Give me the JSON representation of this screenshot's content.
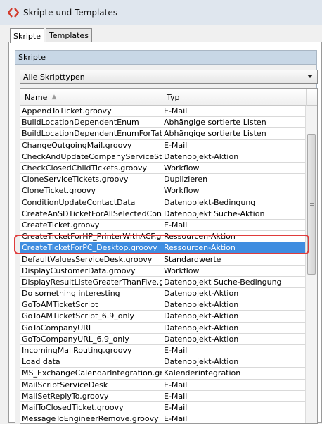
{
  "window": {
    "title": "Skripte und Templates"
  },
  "tabs": [
    {
      "label": "Skripte",
      "active": true
    },
    {
      "label": "Templates",
      "active": false
    }
  ],
  "group": {
    "header": "Skripte"
  },
  "filter": {
    "selected": "Alle Skripttypen"
  },
  "table": {
    "columns": [
      "Name",
      "Typ"
    ],
    "sort_indicator": "▲",
    "rows": [
      {
        "name": "AppendToTicket.groovy",
        "type": "E-Mail"
      },
      {
        "name": "BuildLocationDependentEnum",
        "type": "Abhängige sortierte Listen"
      },
      {
        "name": "BuildLocationDependentEnumForTable",
        "type": "Abhängige sortierte Listen"
      },
      {
        "name": "ChangeOutgoingMail.groovy",
        "type": "E-Mail"
      },
      {
        "name": "CheckAndUpdateCompanyServiceStatus",
        "type": "Datenobjekt-Aktion"
      },
      {
        "name": "CheckClosedChildTickets.groovy",
        "type": "Workflow"
      },
      {
        "name": "CloneServiceTickets.groovy",
        "type": "Duplizieren"
      },
      {
        "name": "CloneTicket.groovy",
        "type": "Workflow"
      },
      {
        "name": "ConditionUpdateContactData",
        "type": "Datenobjekt-Bedingung"
      },
      {
        "name": "CreateAnSDTicketForAllSelectedContacts",
        "type": "Datenobjekt Suche-Aktion"
      },
      {
        "name": "CreateTicket.groovy",
        "type": "E-Mail"
      },
      {
        "name": "CreateTicketForHP_PrinterWithACF.gr...",
        "type": "Ressourcen-Aktion"
      },
      {
        "name": "CreateTicketForPC_Desktop.groovy",
        "type": "Ressourcen-Aktion"
      },
      {
        "name": "DefaultValuesServiceDesk.groovy",
        "type": "Standardwerte"
      },
      {
        "name": "DisplayCustomerData.groovy",
        "type": "Workflow"
      },
      {
        "name": "DisplayResultListeGreaterThanFive.gro...",
        "type": "Datenobjekt Suche-Bedingung"
      },
      {
        "name": "Do something interesting",
        "type": "Datenobjekt-Aktion"
      },
      {
        "name": "GoToAMTicketScript",
        "type": "Datenobjekt-Aktion"
      },
      {
        "name": "GoToAMTicketScript_6.9_only",
        "type": "Datenobjekt-Aktion"
      },
      {
        "name": "GoToCompanyURL",
        "type": "Datenobjekt-Aktion"
      },
      {
        "name": "GoToCompanyURL_6.9_only",
        "type": "Datenobjekt-Aktion"
      },
      {
        "name": "IncomingMailRouting.groovy",
        "type": "E-Mail"
      },
      {
        "name": "Load data",
        "type": "Datenobjekt-Aktion"
      },
      {
        "name": "MS_ExchangeCalendarIntegration.gro...",
        "type": "Kalenderintegration"
      },
      {
        "name": "MailScriptServiceDesk",
        "type": "E-Mail"
      },
      {
        "name": "MailSetReplyTo.groovy",
        "type": "E-Mail"
      },
      {
        "name": "MailToClosedTicket.groovy",
        "type": "E-Mail"
      },
      {
        "name": "MessageToEngineerRemove.groovy",
        "type": "E-Mail"
      }
    ],
    "selected_index": 12
  },
  "colors": {
    "selection": "#3f8de0",
    "highlight": "#e03c3c",
    "header": "#c8d7e6"
  }
}
